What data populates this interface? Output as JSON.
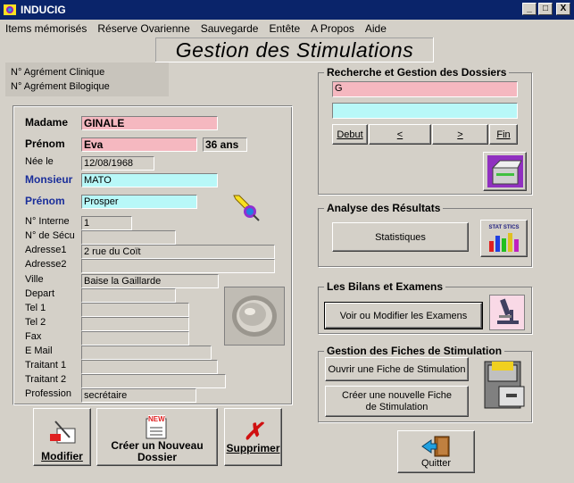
{
  "window": {
    "title": "INDUCIG",
    "minimize": "_",
    "maximize": "□",
    "close": "X"
  },
  "menu": [
    "Items mémorisés",
    "Réserve Ovarienne",
    "Sauvegarde",
    "Entête",
    "A Propos",
    "Aide"
  ],
  "header": {
    "title": "Gestion des Stimulations"
  },
  "agrement": {
    "clinique_label": "N° Agrément Clinique",
    "biologique_label": "N° Agrément Bilogique"
  },
  "patient": {
    "madame_label": "Madame",
    "madame_value": "GINALE",
    "prenom_label": "Prénom",
    "prenom_value": "Eva",
    "age": "36 ans",
    "nee_label": "Née le",
    "nee_value": "12/08/1968",
    "monsieur_label": "Monsieur",
    "monsieur_value": "MATO",
    "prenom2_label": "Prénom",
    "prenom2_value": "Prosper",
    "interne_label": "N° Interne",
    "interne_value": "1",
    "secu_label": "N° de Sécu",
    "secu_value": "",
    "adresse1_label": "Adresse1",
    "adresse1_value": "2 rue du Coït",
    "adresse2_label": "Adresse2",
    "adresse2_value": "",
    "ville_label": "Ville",
    "ville_value": "Baise la Gaillarde",
    "depart_label": "Depart",
    "depart_value": "",
    "tel1_label": "Tel 1",
    "tel1_value": "",
    "tel2_label": "Tel 2",
    "tel2_value": "",
    "fax_label": "Fax",
    "fax_value": "",
    "email_label": "E Mail",
    "email_value": "",
    "traitant1_label": "Traitant 1",
    "traitant1_value": "",
    "traitant2_label": "Traitant 2",
    "traitant2_value": "",
    "profession_label": "Profession",
    "profession_value": "secrétaire"
  },
  "actions": {
    "modifier": "Modifier",
    "creer": "Créer un Nouveau Dossier",
    "supprimer": "Supprimer",
    "new_badge": "NEW"
  },
  "recherche": {
    "title": "Recherche et Gestion des Dossiers",
    "search_value": "G",
    "second_value": "",
    "debut": "Debut",
    "prev": "<",
    "next": ">",
    "fin": "Fin"
  },
  "analyse": {
    "title": "Analyse des Résultats",
    "statistiques": "Statistiques",
    "stat_icon_text": "STAT STICS"
  },
  "bilans": {
    "title": "Les Bilans et Examens",
    "voir": "Voir ou Modifier les Examens"
  },
  "fiches": {
    "title": "Gestion des Fiches de Stimulation",
    "ouvrir": "Ouvrir une Fiche de Stimulation",
    "creer": "Créer une nouvelle Fiche de Stimulation"
  },
  "quitter": "Quitter",
  "colors": {
    "titlebar": "#0a246a",
    "pink_field": "#f5b8c0",
    "cyan_field": "#b8f8f8",
    "blue_label": "#1a2e9a"
  }
}
